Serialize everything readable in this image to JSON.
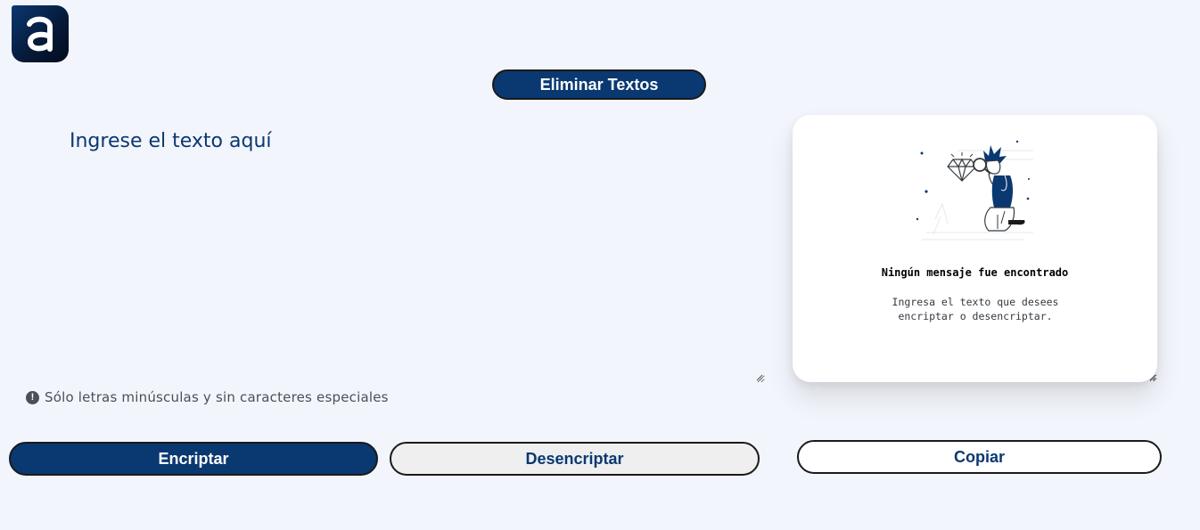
{
  "logo": {
    "icon": "alura-logo-icon",
    "glyph": "a"
  },
  "toolbar": {
    "clear_label": "Eliminar Textos"
  },
  "input": {
    "placeholder": "Ingrese el texto aquí",
    "value": ""
  },
  "warning": {
    "icon": "exclamation-circle-icon",
    "text": "Sólo letras minúsculas y sin caracteres especiales"
  },
  "actions": {
    "encrypt_label": "Encriptar",
    "decrypt_label": "Desencriptar",
    "copy_label": "Copiar"
  },
  "output": {
    "illustration": "person-with-magnifying-glass-illustration",
    "title": "Ningún mensaje fue encontrado",
    "description": "Ingresa el texto que desees encriptar o desencriptar."
  },
  "colors": {
    "background": "#f3f5fc",
    "primary": "#0a3871",
    "secondary": "#efefef",
    "text_muted": "#495057"
  }
}
